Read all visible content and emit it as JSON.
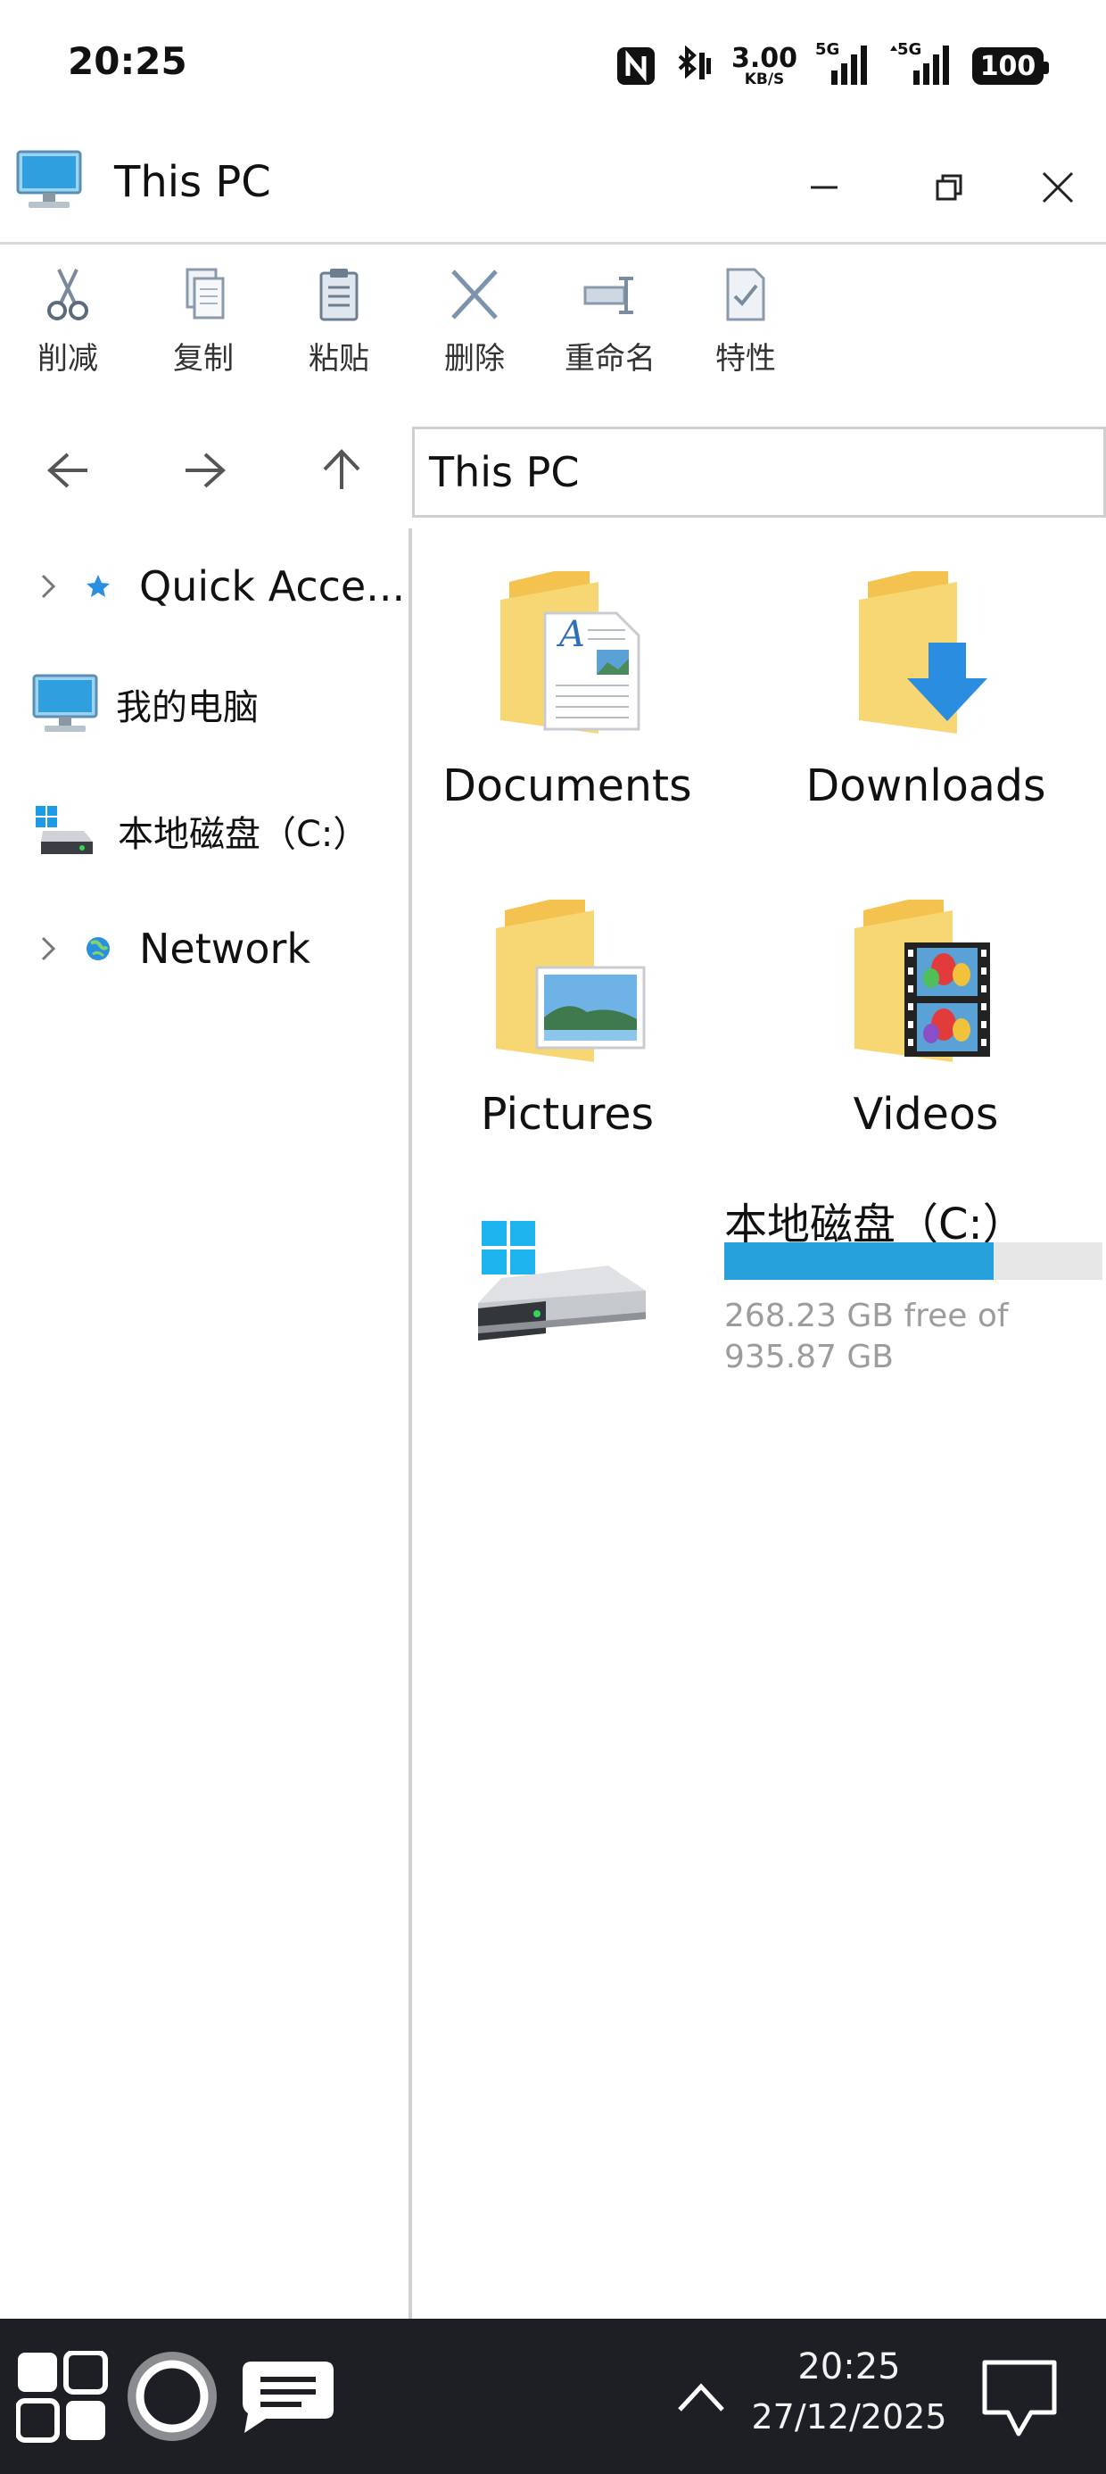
{
  "status_bar": {
    "time": "20:25",
    "net_speed_value": "3.00",
    "net_speed_unit": "KB/S",
    "signal1_label": "5G",
    "signal2_label": "5G",
    "battery": "100",
    "icons": [
      "nfc-icon",
      "bluetooth-icon",
      "signal-icon",
      "battery-icon"
    ]
  },
  "window": {
    "title": "This PC",
    "icon": "computer-icon"
  },
  "toolbar": {
    "cut_label": "削减",
    "copy_label": "复制",
    "paste_label": "粘贴",
    "delete_label": "删除",
    "rename_label": "重命名",
    "properties_label": "特性"
  },
  "address_bar": {
    "path": "This PC"
  },
  "sidebar": {
    "items": [
      {
        "label": "Quick Acce...",
        "icon": "star-icon"
      },
      {
        "label": "我的电脑",
        "icon": "computer-icon"
      },
      {
        "label": "本地磁盘（C:）",
        "icon": "drive-icon"
      },
      {
        "label": "Network",
        "icon": "network-icon"
      }
    ]
  },
  "content": {
    "folders": [
      {
        "name": "Documents",
        "icon": "documents-folder-icon"
      },
      {
        "name": "Downloads",
        "icon": "downloads-folder-icon"
      },
      {
        "name": "Pictures",
        "icon": "pictures-folder-icon"
      },
      {
        "name": "Videos",
        "icon": "videos-folder-icon"
      }
    ],
    "drive": {
      "name": "本地磁盘（C:）",
      "free_text": "268.23 GB free of 935.87 GB",
      "used_fraction": 0.713,
      "bar_color": "#26a0da"
    }
  },
  "taskbar": {
    "time": "20:25",
    "date": "27/12/2025"
  },
  "colors": {
    "accent": "#26a0da",
    "taskbar": "#1d1f24",
    "folder": "#f7d774"
  }
}
